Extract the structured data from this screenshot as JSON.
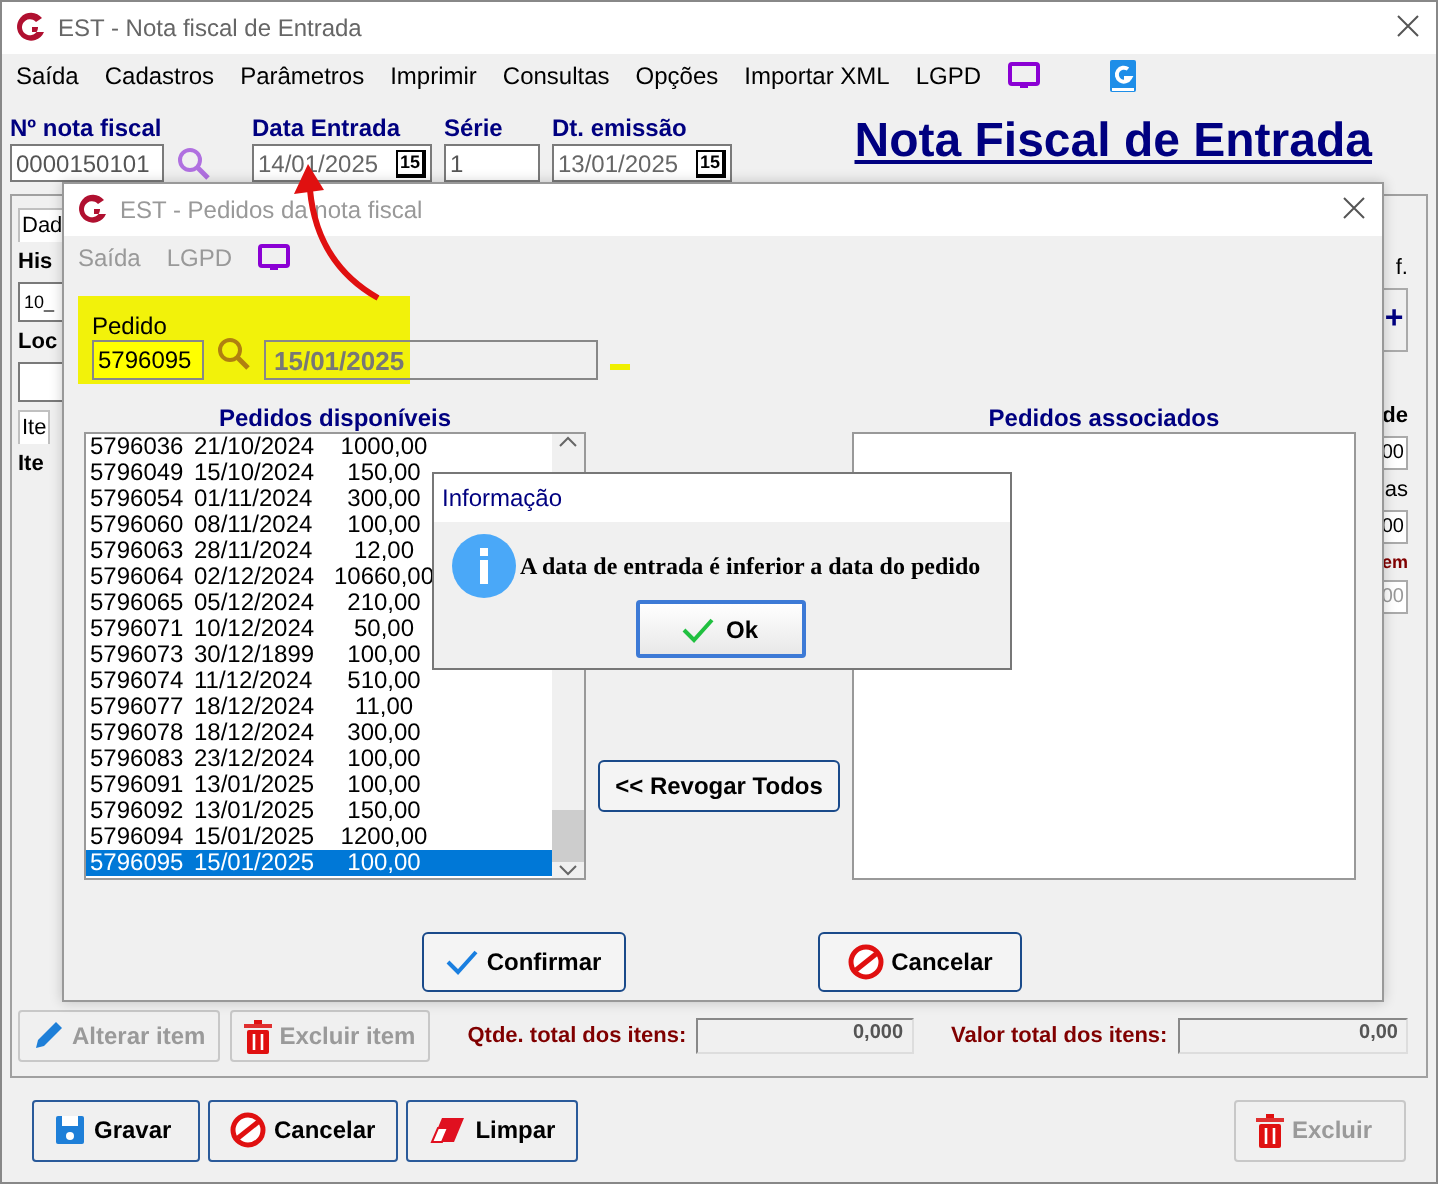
{
  "window": {
    "title": "EST - Nota fiscal de Entrada"
  },
  "menu": [
    {
      "label": "Saída"
    },
    {
      "label": "Cadastros"
    },
    {
      "label": "Parâmetros"
    },
    {
      "label": "Imprimir"
    },
    {
      "label": "Consultas"
    },
    {
      "label": "Opções"
    },
    {
      "label": "Importar XML"
    },
    {
      "label": "LGPD"
    }
  ],
  "header": {
    "fields": [
      {
        "label": "Nº nota fiscal",
        "value": "0000150101",
        "kind": "search"
      },
      {
        "label": "Data Entrada",
        "value": "14/01/2025",
        "kind": "date",
        "calendar": "15"
      },
      {
        "label": "Série",
        "value": "1",
        "kind": "text"
      },
      {
        "label": "Dt. emissão",
        "value": "13/01/2025",
        "kind": "date",
        "calendar": "15"
      }
    ],
    "title": "Nota Fiscal de Entrada"
  },
  "background_left": {
    "tab": "Dad",
    "label_1": "His",
    "field": "10_",
    "label_2": "Loc",
    "tab_2": "Ite",
    "label_3": "Ite"
  },
  "background_right": {
    "label_1": "f.",
    "add_button": "+",
    "label_2": "de",
    "value_1": "00",
    "label_3": "as",
    "value_2": "00",
    "label_4": "em",
    "value_3": "00"
  },
  "item_actions": [
    {
      "label": "Alterar item",
      "disabled": true,
      "kind": "edit"
    },
    {
      "label": "Excluir item",
      "disabled": true,
      "kind": "delete"
    }
  ],
  "totals": [
    {
      "label": "Qtde. total dos itens:",
      "value": "0,000"
    },
    {
      "label": "Valor total dos itens:",
      "value": "0,00"
    }
  ],
  "footer_buttons": [
    {
      "label": "Gravar",
      "disabled": false,
      "kind": "save"
    },
    {
      "label": "Cancelar",
      "disabled": false,
      "kind": "cancel"
    },
    {
      "label": "Limpar",
      "disabled": false,
      "kind": "clear"
    },
    {
      "label": "Excluir",
      "disabled": true,
      "kind": "delete"
    }
  ],
  "orders_dialog": {
    "title": "EST - Pedidos da nota fiscal",
    "menu": [
      {
        "label": "Saída",
        "disabled": true
      },
      {
        "label": "LGPD",
        "disabled": true
      }
    ],
    "pedido": {
      "label": "Pedido",
      "value": "5796095",
      "date": "15/01/2025"
    },
    "available": {
      "heading": "Pedidos disponíveis",
      "rows": [
        {
          "id": "5796036",
          "date": "21/10/2024",
          "value": "1000,00",
          "selected": false
        },
        {
          "id": "5796049",
          "date": "15/10/2024",
          "value": "150,00",
          "selected": false
        },
        {
          "id": "5796054",
          "date": "01/11/2024",
          "value": "300,00",
          "selected": false
        },
        {
          "id": "5796060",
          "date": "08/11/2024",
          "value": "100,00",
          "selected": false
        },
        {
          "id": "5796063",
          "date": "28/11/2024",
          "value": "12,00",
          "selected": false
        },
        {
          "id": "5796064",
          "date": "02/12/2024",
          "value": "10660,00",
          "selected": false
        },
        {
          "id": "5796065",
          "date": "05/12/2024",
          "value": "210,00",
          "selected": false
        },
        {
          "id": "5796071",
          "date": "10/12/2024",
          "value": "50,00",
          "selected": false
        },
        {
          "id": "5796073",
          "date": "30/12/1899",
          "value": "100,00",
          "selected": false
        },
        {
          "id": "5796074",
          "date": "11/12/2024",
          "value": "510,00",
          "selected": false
        },
        {
          "id": "5796077",
          "date": "18/12/2024",
          "value": "11,00",
          "selected": false
        },
        {
          "id": "5796078",
          "date": "18/12/2024",
          "value": "300,00",
          "selected": false
        },
        {
          "id": "5796083",
          "date": "23/12/2024",
          "value": "100,00",
          "selected": false
        },
        {
          "id": "5796091",
          "date": "13/01/2025",
          "value": "100,00",
          "selected": false
        },
        {
          "id": "5796092",
          "date": "13/01/2025",
          "value": "150,00",
          "selected": false
        },
        {
          "id": "5796094",
          "date": "15/01/2025",
          "value": "1200,00",
          "selected": false
        },
        {
          "id": "5796095",
          "date": "15/01/2025",
          "value": "100,00",
          "selected": true
        }
      ]
    },
    "revoke_button": "<< Revogar Todos",
    "associated": {
      "heading": "Pedidos associados"
    },
    "buttons": [
      {
        "label": "Confirmar",
        "kind": "confirm"
      },
      {
        "label": "Cancelar",
        "kind": "cancel"
      }
    ]
  },
  "message_box": {
    "title": "Informação",
    "message": "A data de entrada é inferior a data do pedido",
    "button": "Ok"
  }
}
